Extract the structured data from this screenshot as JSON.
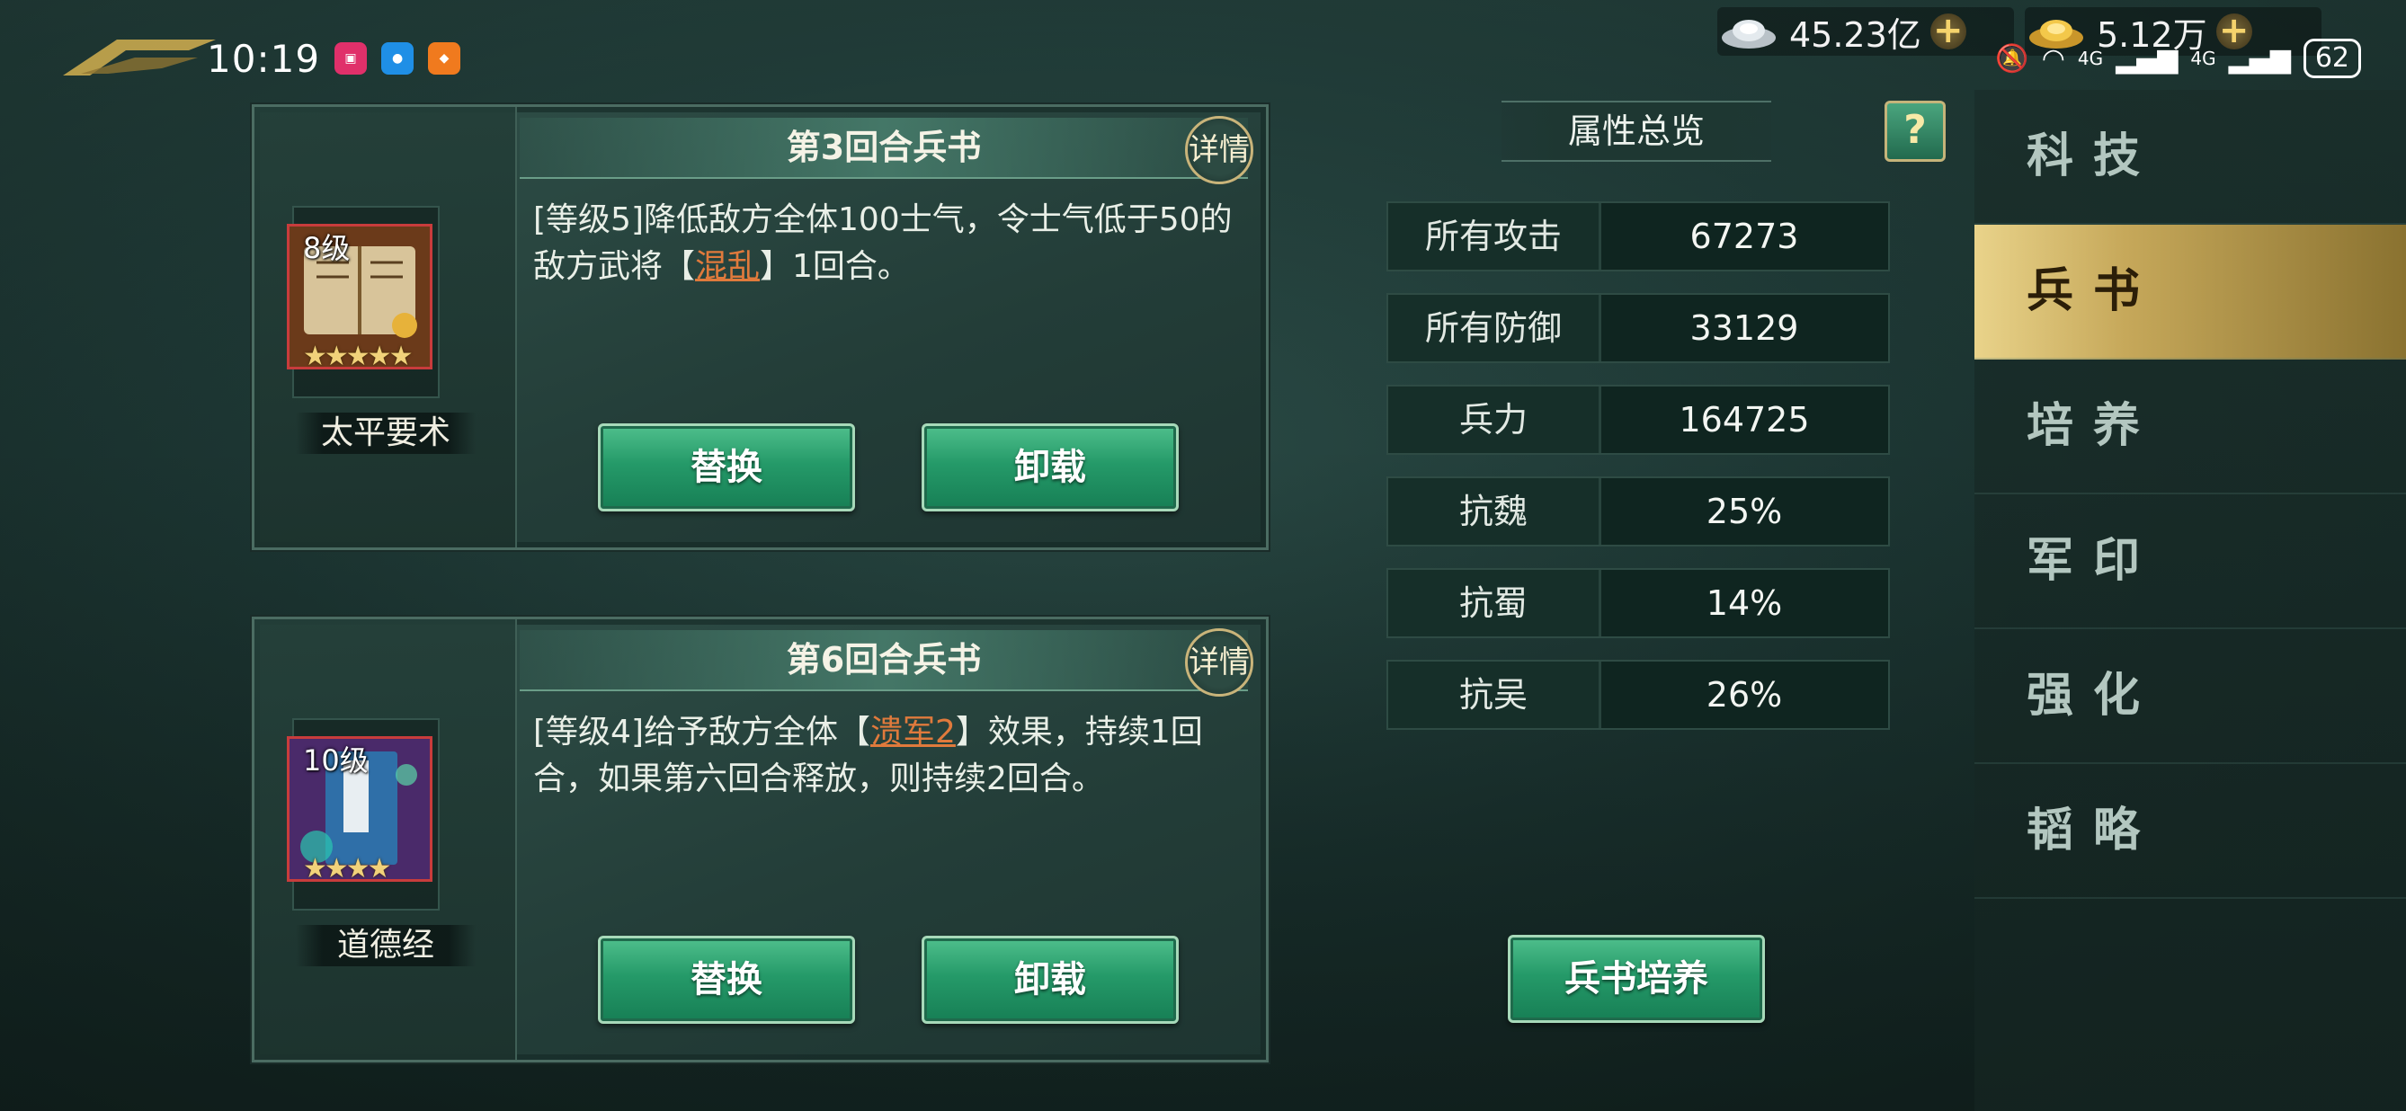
{
  "status": {
    "time": "10:19",
    "battery": "62",
    "network_a": "4G",
    "network_b": "4G"
  },
  "currency": {
    "silver": "45.23亿",
    "gold": "5.12万",
    "plus": "+"
  },
  "cards": [
    {
      "title": "第3回合兵书",
      "detail": "详情",
      "desc_before": "[等级5]降低敌方全体100士气，令士气低于50的敌方武将【",
      "desc_link": "混乱",
      "desc_after": "】1回合。",
      "level": "8级",
      "stars": "★★★★★",
      "name": "太平要术",
      "replace": "替换",
      "unload": "卸载"
    },
    {
      "title": "第6回合兵书",
      "detail": "详情",
      "desc_before": "[等级4]给予敌方全体【",
      "desc_link": "溃军2",
      "desc_after": "】效果，持续1回合，如果第六回合释放，则持续2回合。",
      "level": "10级",
      "stars": "★★★★",
      "name": "道德经",
      "replace": "替换",
      "unload": "卸载"
    }
  ],
  "overview": {
    "title": "属性总览",
    "help": "?",
    "rows": [
      {
        "name": "所有攻击",
        "value": "67273"
      },
      {
        "name": "所有防御",
        "value": "33129"
      },
      {
        "name": "兵力",
        "value": "164725"
      },
      {
        "name": "抗魏",
        "value": "25%"
      },
      {
        "name": "抗蜀",
        "value": "14%"
      },
      {
        "name": "抗吴",
        "value": "26%"
      }
    ],
    "train_button": "兵书培养"
  },
  "nav": {
    "items": [
      "科技",
      "兵书",
      "培养",
      "军印",
      "强化",
      "韬略"
    ],
    "active": "兵书"
  },
  "colors": {
    "accent_green": "#259a69",
    "gold": "#c6a85a",
    "link_orange": "#e07a3c"
  }
}
